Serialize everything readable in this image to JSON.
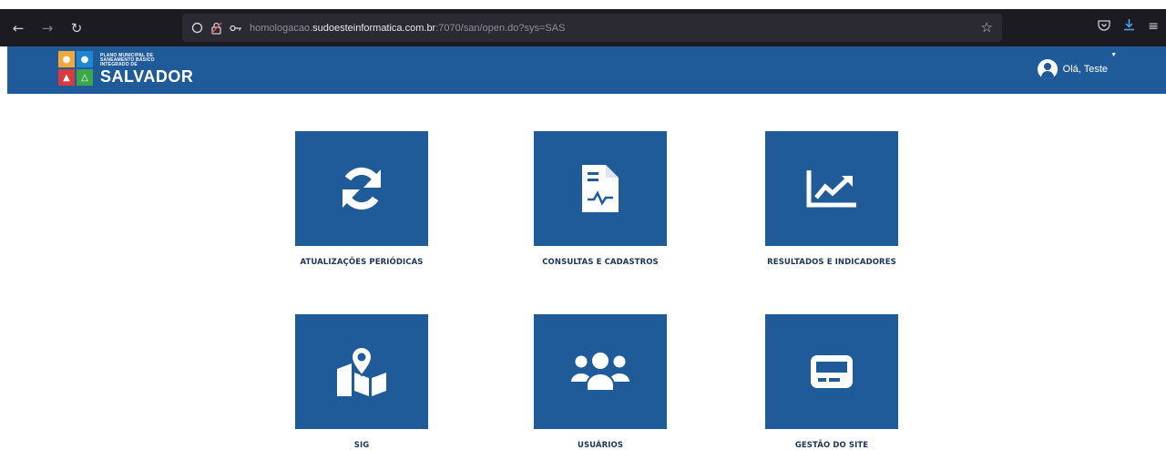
{
  "browser": {
    "url_prefix": "homologacao.",
    "url_host": "sudoesteinformatica.com.br",
    "url_suffix": ":7070/san/open.do?sys=SAS",
    "icons": [
      "back-icon",
      "forward-icon",
      "reload-icon",
      "shield-icon",
      "lock-slash-icon",
      "key-icon",
      "star-icon",
      "pocket-icon",
      "download-icon",
      "menu-icon"
    ]
  },
  "header": {
    "logo_small_1": "PLANO MUNICIPAL DE",
    "logo_small_2": "SANEAMENTO BÁSICO",
    "logo_small_3": "INTEGRADO DE",
    "logo_big": "SALVADOR",
    "greeting": "Olá, Teste",
    "bg_color": "#1f5a99"
  },
  "tiles": [
    {
      "label": "ATUALIZAÇÕES PERIÓDICAS",
      "icon": "sync-icon"
    },
    {
      "label": "CONSULTAS E CADASTROS",
      "icon": "document-chart-icon"
    },
    {
      "label": "RESULTADOS E INDICADORES",
      "icon": "line-chart-icon"
    },
    {
      "label": "SIG",
      "icon": "map-pin-icon"
    },
    {
      "label": "USUÁRIOS",
      "icon": "users-icon"
    },
    {
      "label": "GESTÃO DO SITE",
      "icon": "card-icon"
    }
  ],
  "colors": {
    "tile": "#1f5a99",
    "label": "#1b3557",
    "browser_bg": "#1c1b22"
  }
}
